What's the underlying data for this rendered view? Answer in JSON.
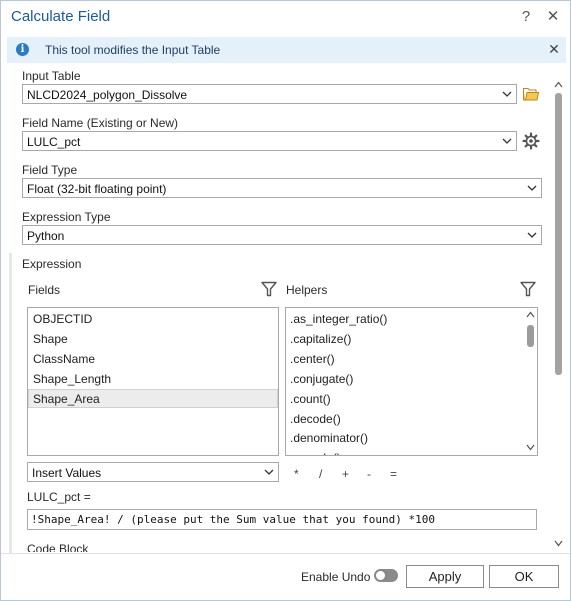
{
  "window": {
    "title": "Calculate Field",
    "help": "?",
    "close": "✕"
  },
  "info": {
    "text": "This tool modifies the Input Table",
    "close": "✕"
  },
  "input_table": {
    "label": "Input Table",
    "value": "NLCD2024_polygon_Dissolve"
  },
  "field_name": {
    "label": "Field Name (Existing or New)",
    "value": "LULC_pct"
  },
  "field_type": {
    "label": "Field Type",
    "value": "Float (32-bit floating point)"
  },
  "expression_type": {
    "label": "Expression Type",
    "value": "Python"
  },
  "expression": {
    "label": "Expression",
    "fields_label": "Fields",
    "helpers_label": "Helpers",
    "fields": [
      "OBJECTID",
      "Shape",
      "ClassName",
      "Shape_Length",
      "Shape_Area"
    ],
    "selected_field": "Shape_Area",
    "helpers": [
      ".as_integer_ratio()",
      ".capitalize()",
      ".center()",
      ".conjugate()",
      ".count()",
      ".decode()",
      ".denominator()",
      ".encode()"
    ],
    "insert_values": "Insert Values",
    "operators": [
      "*",
      "/",
      "+",
      "-",
      "="
    ],
    "target_label": "LULC_pct =",
    "code": "!Shape_Area! / (please put the Sum value that you found) *100"
  },
  "code_block": {
    "label": "Code Block"
  },
  "footer": {
    "enable_undo": "Enable Undo",
    "enable_undo_on": false,
    "apply": "Apply",
    "ok": "OK"
  },
  "colors": {
    "title": "#1b5a9c",
    "info_bg": "#e4f1fb",
    "info_icon": "#2a7bc2",
    "folder": "#e2b13c"
  },
  "icons": {
    "info": "info-icon",
    "folder": "folder-icon",
    "settings": "gear-icon",
    "filter": "filter-icon",
    "dropdown": "chevron-down-icon"
  }
}
